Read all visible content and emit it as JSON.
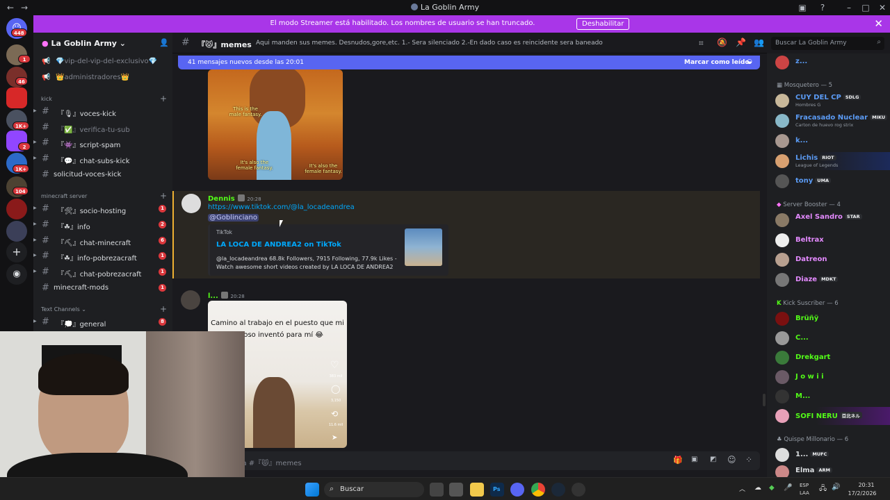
{
  "window": {
    "title": "La Goblin Army"
  },
  "banner": {
    "message": "El modo Streamer está habilitado. Los nombres de usuario se han truncado.",
    "button": "Deshabilitar"
  },
  "servers": [
    {
      "badge": "448"
    },
    {
      "badge": "1"
    },
    {
      "badge": "46"
    },
    {
      "badge": ""
    },
    {
      "badge": "1K+"
    },
    {
      "badge": "2"
    },
    {
      "badge": "1K+"
    },
    {
      "badge": "104"
    },
    {
      "badge": ""
    },
    {
      "badge": ""
    }
  ],
  "sidebar": {
    "server_name": "La Goblin Army",
    "top_channels": [
      {
        "name": "vip-del-vip-del-exclusivo"
      },
      {
        "name": "administradores"
      }
    ],
    "categories": [
      {
        "label": "kick",
        "channels": [
          {
            "name": "『🎙』voces-kick",
            "badge": ""
          },
          {
            "name": "『✅』verifica-tu-sub",
            "badge": "",
            "muted": true
          },
          {
            "name": "『👾』script-spam",
            "badge": ""
          },
          {
            "name": "『💬』chat-subs-kick",
            "badge": ""
          },
          {
            "name": "solicitud-voces-kick",
            "badge": ""
          }
        ]
      },
      {
        "label": "minecraft server",
        "channels": [
          {
            "name": "『🛠』socio-hosting",
            "badge": "1"
          },
          {
            "name": "『☘』info",
            "badge": "2"
          },
          {
            "name": "『⛏』chat-minecraft",
            "badge": "6"
          },
          {
            "name": "『☘』info-pobrezacraft",
            "badge": "1"
          },
          {
            "name": "『⛏』chat-pobrezacraft",
            "badge": "1"
          },
          {
            "name": "minecraft-mods",
            "badge": "1"
          }
        ]
      },
      {
        "label": "Text Channels",
        "channels": [
          {
            "name": "『💭』general",
            "badge": "8"
          }
        ]
      }
    ]
  },
  "channel_header": {
    "name": "『😾』memes",
    "topic": "Aqui manden sus memes. Desnudos,gore,etc. 1.- Sera silenciado 2.-En dado caso es reincidente sera baneado",
    "search_placeholder": "Buscar La Goblin Army"
  },
  "new_messages_bar": {
    "text": "41 mensajes nuevos desde las 20:01",
    "action": "Marcar como leído"
  },
  "meme_image": {
    "caption_top": "This is the male fantasy.",
    "caption_left": "It's also the female fantasy.",
    "caption_right": "It's also the female fantasy."
  },
  "messages": [
    {
      "author": "Dennis",
      "time": "20:28",
      "link": "https://www.tiktok.com/@la_locadeandrea",
      "mention": "@Goblinciano",
      "embed": {
        "provider": "TikTok",
        "title": "LA LOCA DE ANDREA2 on TikTok",
        "description": "@la_locadeandrea 68.8k Followers, 7915 Following, 77.9k Likes - Watch awesome short videos created by LA LOCA DE ANDREA2"
      }
    },
    {
      "author": "l...",
      "time": "20:28",
      "video_caption": "Camino al trabajo en el puesto que mi [...]oso inventó para mí 😂",
      "video_stats": [
        "383 mil",
        "3,150",
        "11.6 mil"
      ]
    }
  ],
  "composer": {
    "placeholder": "Enviar mensaje a #『😾』memes"
  },
  "members": {
    "top_partial": {
      "name": "z..."
    },
    "groups": [
      {
        "role": "Mosquetero — 5",
        "members": [
          {
            "name": "CUY DEL CP",
            "tag": "SDLG",
            "sub": "Hombres G",
            "color": "#5b9bf5"
          },
          {
            "name": "Fracasado Nuclear",
            "tag": "MIKU",
            "sub": "Carton de huevo rog strix",
            "color": "#5b9bf5"
          },
          {
            "name": "k...",
            "tag": "",
            "sub": "",
            "color": "#5b9bf5"
          },
          {
            "name": "Lichis",
            "tag": "RIOT",
            "sub": "League of Legends",
            "color": "#5b9bf5"
          },
          {
            "name": "tony",
            "tag": "UMA",
            "sub": "",
            "color": "#5b9bf5"
          }
        ]
      },
      {
        "role": "Server Booster — 4",
        "members": [
          {
            "name": "Axel Sandro",
            "tag": "STAR",
            "sub": "",
            "color": "#e48aff"
          },
          {
            "name": "Beltrax",
            "tag": "",
            "sub": "",
            "color": "#e48aff"
          },
          {
            "name": "Datreon",
            "tag": "",
            "sub": "",
            "color": "#e48aff"
          },
          {
            "name": "Diaze",
            "tag": "MDKT",
            "sub": "",
            "color": "#e48aff"
          }
        ]
      },
      {
        "role": "Kick Suscriber — 6",
        "members": [
          {
            "name": "Brüñÿ",
            "tag": "",
            "sub": "",
            "color": "#53fc18"
          },
          {
            "name": "C...",
            "tag": "",
            "sub": "",
            "color": "#53fc18"
          },
          {
            "name": "Drekgart",
            "tag": "",
            "sub": "",
            "color": "#53fc18"
          },
          {
            "name": "J o w i i",
            "tag": "",
            "sub": "",
            "color": "#53fc18"
          },
          {
            "name": "M...",
            "tag": "",
            "sub": "",
            "color": "#53fc18"
          },
          {
            "name": "SOFI NERU",
            "tag": "亞北ネル",
            "sub": "",
            "color": "#53fc18"
          }
        ]
      },
      {
        "role": "Quispe Millonario — 6",
        "members": [
          {
            "name": "1...",
            "tag": "MUFC",
            "sub": "",
            "color": "#dbdee1"
          },
          {
            "name": "Elma",
            "tag": "ARM",
            "sub": "",
            "color": "#dbdee1"
          }
        ]
      }
    ]
  },
  "taskbar": {
    "search_label": "Buscar",
    "lang": "ESP",
    "lang2": "LAA",
    "time": "20:31",
    "date": "17/2/2026"
  }
}
